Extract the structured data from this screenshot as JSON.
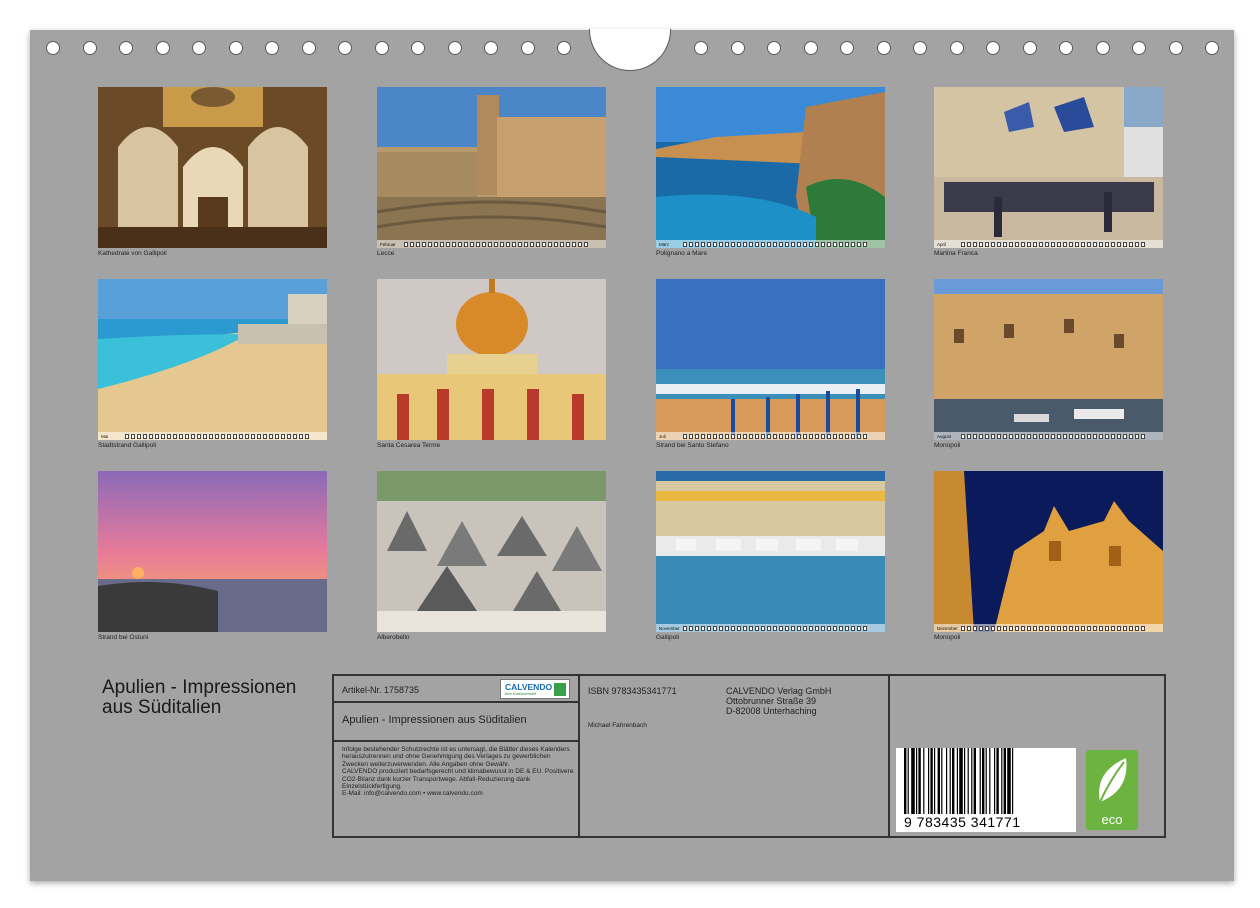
{
  "calendar": {
    "title": "Apulien - Impressionen aus Süditalien",
    "photos": [
      {
        "caption": "Kathedrale von Gallipoli",
        "month": ""
      },
      {
        "caption": "Lecce",
        "month": "Februar"
      },
      {
        "caption": "Polignano a Mare",
        "month": "März"
      },
      {
        "caption": "Martina Franca",
        "month": "April"
      },
      {
        "caption": "Stadtstrand Gallipoli",
        "month": "Mai"
      },
      {
        "caption": "Santa Cesarea Terme",
        "month": ""
      },
      {
        "caption": "Strand bei Santo Stefano",
        "month": "Juli"
      },
      {
        "caption": "Monopoli",
        "month": "August"
      },
      {
        "caption": "Strand bei Ostuni",
        "month": ""
      },
      {
        "caption": "Alberobello",
        "month": ""
      },
      {
        "caption": "Gallipoli",
        "month": "November"
      },
      {
        "caption": "Monopoli",
        "month": "Dezember"
      }
    ]
  },
  "info": {
    "article": "Artikel-Nr. 1758735",
    "subtitle": "Apulien - Impressionen aus Süditalien",
    "logo_name": "CALVENDO",
    "logo_tagline": "Ihre Kalenderwelt",
    "legal_text": "Infolge bestehender Schutzrechte ist es untersagt, die Blätter dieses Kalenders herauszutrennen und ohne Genehmigung des Verlages zu gewerblichen Zwecken weiterzuverwenden. Alle Angaben ohne Gewähr.\nCALVENDO produziert bedarfsgerecht und klimabewusst in DE & EU. Positivere CO2-Bilanz dank kurzer Transportwege. Abfall-Reduzierung dank Einzelstückfertigung.\nE-Mail: info@calvendo.com • www.calvendo.com",
    "isbn": "ISBN 9783435341771",
    "author": "Michael Fahrenbach",
    "publisher_name": "CALVENDO Verlag GmbH",
    "publisher_street": "Ottobrunner Straße 39",
    "publisher_city": "D-82008 Unterhaching",
    "barcode_digits": "9 783435 341771",
    "eco_label": "eco"
  }
}
